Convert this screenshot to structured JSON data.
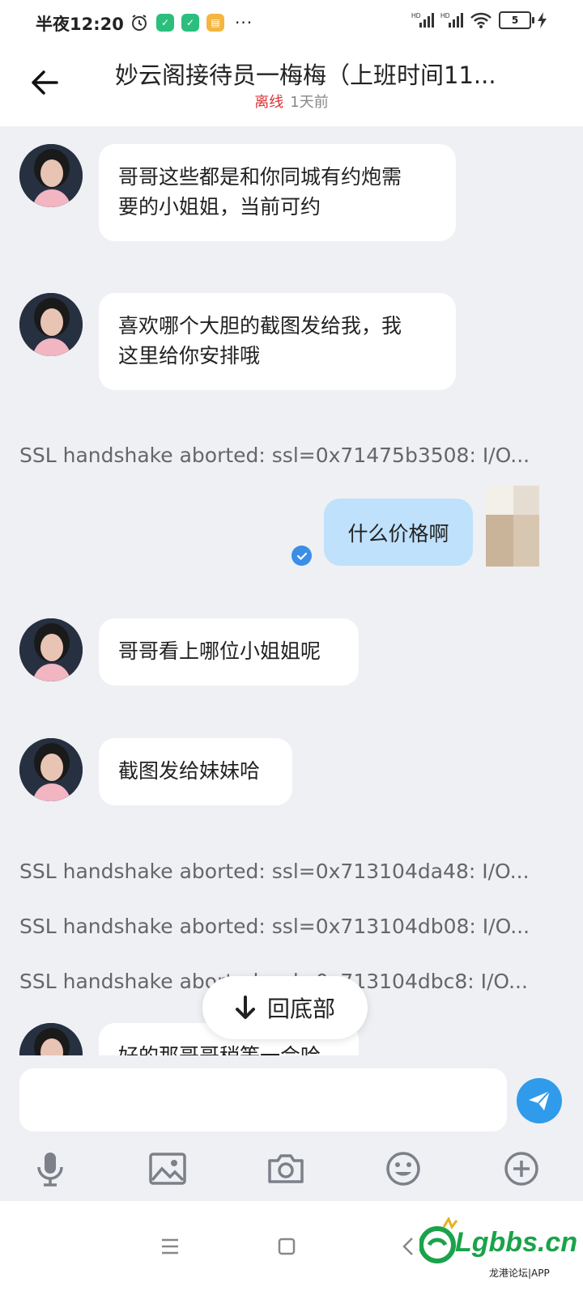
{
  "status_bar": {
    "time": "半夜12:20",
    "more": "···",
    "battery": "5",
    "network": "HD"
  },
  "header": {
    "title": "妙云阁接待员一梅梅（上班时间11...",
    "status": "离线",
    "last_seen": "1天前"
  },
  "messages": [
    {
      "from": "agent",
      "lines": [
        "哥哥这些都是和你同城有约炮需",
        "要的小姐姐，当前可约"
      ]
    },
    {
      "from": "agent",
      "lines": [
        "喜欢哪个大胆的截图发给我，我",
        "这里给你安排哦"
      ]
    },
    {
      "from": "system",
      "text": "SSL handshake aborted: ssl=0x71475b3508: I/O..."
    },
    {
      "from": "me",
      "text": "什么价格啊"
    },
    {
      "from": "agent",
      "text": "哥哥看上哪位小姐姐呢"
    },
    {
      "from": "agent",
      "text": "截图发给妹妹哈"
    },
    {
      "from": "system",
      "text": "SSL handshake aborted: ssl=0x713104da48: I/O..."
    },
    {
      "from": "system",
      "text": "SSL handshake aborted: ssl=0x713104db08: I/O..."
    },
    {
      "from": "system",
      "text": "SSL handshake aborted: ssl=0x713104dbc8: I/O..."
    },
    {
      "from": "agent",
      "text": "好的那哥哥稍等一会哈"
    }
  ],
  "scroll_to_bottom": "回底部",
  "composer": {
    "placeholder": ""
  },
  "toolbar": [
    "microphone-icon",
    "image-icon",
    "camera-icon",
    "emoji-icon",
    "plus-icon"
  ],
  "watermark": {
    "brand": "Lgbbs.cn",
    "sub": "龙港论坛|APP"
  },
  "colors": {
    "accent": "#2f9bea",
    "my_bubble": "#bfe1fb",
    "offline": "#dd3333"
  }
}
